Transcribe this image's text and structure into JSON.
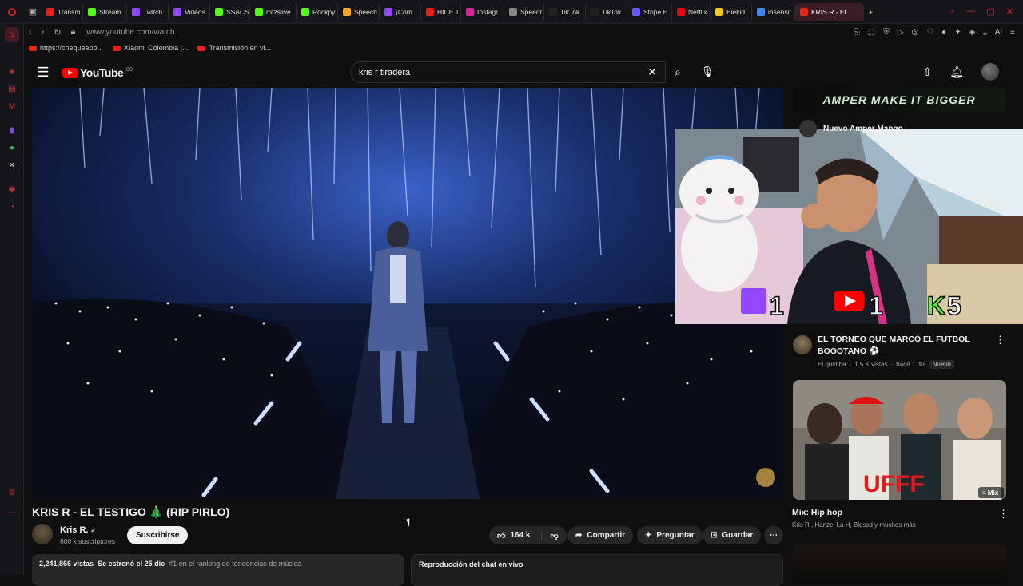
{
  "browser": {
    "tabs": [
      {
        "label": "Transm",
        "color": "#e62117",
        "active": false
      },
      {
        "label": "Stream",
        "color": "#53fc18",
        "active": false
      },
      {
        "label": "Twitch",
        "color": "#9146ff",
        "active": false
      },
      {
        "label": "Videos",
        "color": "#9146ff",
        "active": false
      },
      {
        "label": "SSACS",
        "color": "#53fc18",
        "active": false
      },
      {
        "label": "mtzslive",
        "color": "#53fc18",
        "active": false
      },
      {
        "label": "Rockpy",
        "color": "#53fc18",
        "active": false
      },
      {
        "label": "Speech",
        "color": "#f5a623",
        "active": false
      },
      {
        "label": "¡Cóm",
        "color": "#9146ff",
        "active": false
      },
      {
        "label": "HICE T",
        "color": "#e62117",
        "active": false
      },
      {
        "label": "Instagr",
        "color": "#d6249f",
        "active": false
      },
      {
        "label": "Speedt",
        "color": "#888888",
        "active": false
      },
      {
        "label": "TikTok",
        "color": "#222222",
        "active": false
      },
      {
        "label": "TikTok",
        "color": "#222222",
        "active": false
      },
      {
        "label": "Stripe E",
        "color": "#635bff",
        "active": false
      },
      {
        "label": "Netflix",
        "color": "#e50914",
        "active": false
      },
      {
        "label": "Elekid",
        "color": "#f5c518",
        "active": false
      },
      {
        "label": "insensit",
        "color": "#4285f4",
        "active": false
      },
      {
        "label": "KRIS R - EL",
        "color": "#e62117",
        "active": true
      }
    ],
    "url": "www.youtube.com/watch",
    "bookmarks": [
      "https://chequeabo...",
      "Xiaomi Colombia |...",
      "Transmisión en vi..."
    ],
    "ai_label": "AI"
  },
  "youtube": {
    "logo_text": "YouTube",
    "country": "CO",
    "search_value": "kris r tiradera"
  },
  "video": {
    "title": "KRIS R - EL TESTIGO 🎄 (RIP PIRLO)",
    "channel": "Kris R.",
    "subscribers": "600 k suscriptores",
    "subscribe_label": "Suscribirse",
    "likes": "164 k",
    "share_label": "Compartir",
    "ask_label": "Preguntar",
    "save_label": "Guardar",
    "views": "2,241,866 vistas",
    "premiered": "Se estrenó el 25 dic",
    "trending": "#1 en el ranking de tendencias de música",
    "chat_replay": "Reproducción del chat en vivo"
  },
  "ad": {
    "banner": "AMPER  MAKE IT BIGGER",
    "title": "Nuevo Amper Mango"
  },
  "stream_overlay": {
    "twitch_count": "1",
    "youtube_count": "1",
    "kick_count": "5"
  },
  "recommendations": [
    {
      "title": "EL TORNEO QUE MARCÓ EL FUTBOL BOGOTANO ⚽",
      "channel": "El quimba",
      "views": "1.5 K vistas",
      "age": "hace 1 día",
      "badge": "Nuevo"
    }
  ],
  "mix": {
    "title": "Mix: Hip hop",
    "subtitle": "Kris R., Hanzel La H, Blessd y muchos más",
    "label": "Mix",
    "thumb_text": "UFFF"
  }
}
